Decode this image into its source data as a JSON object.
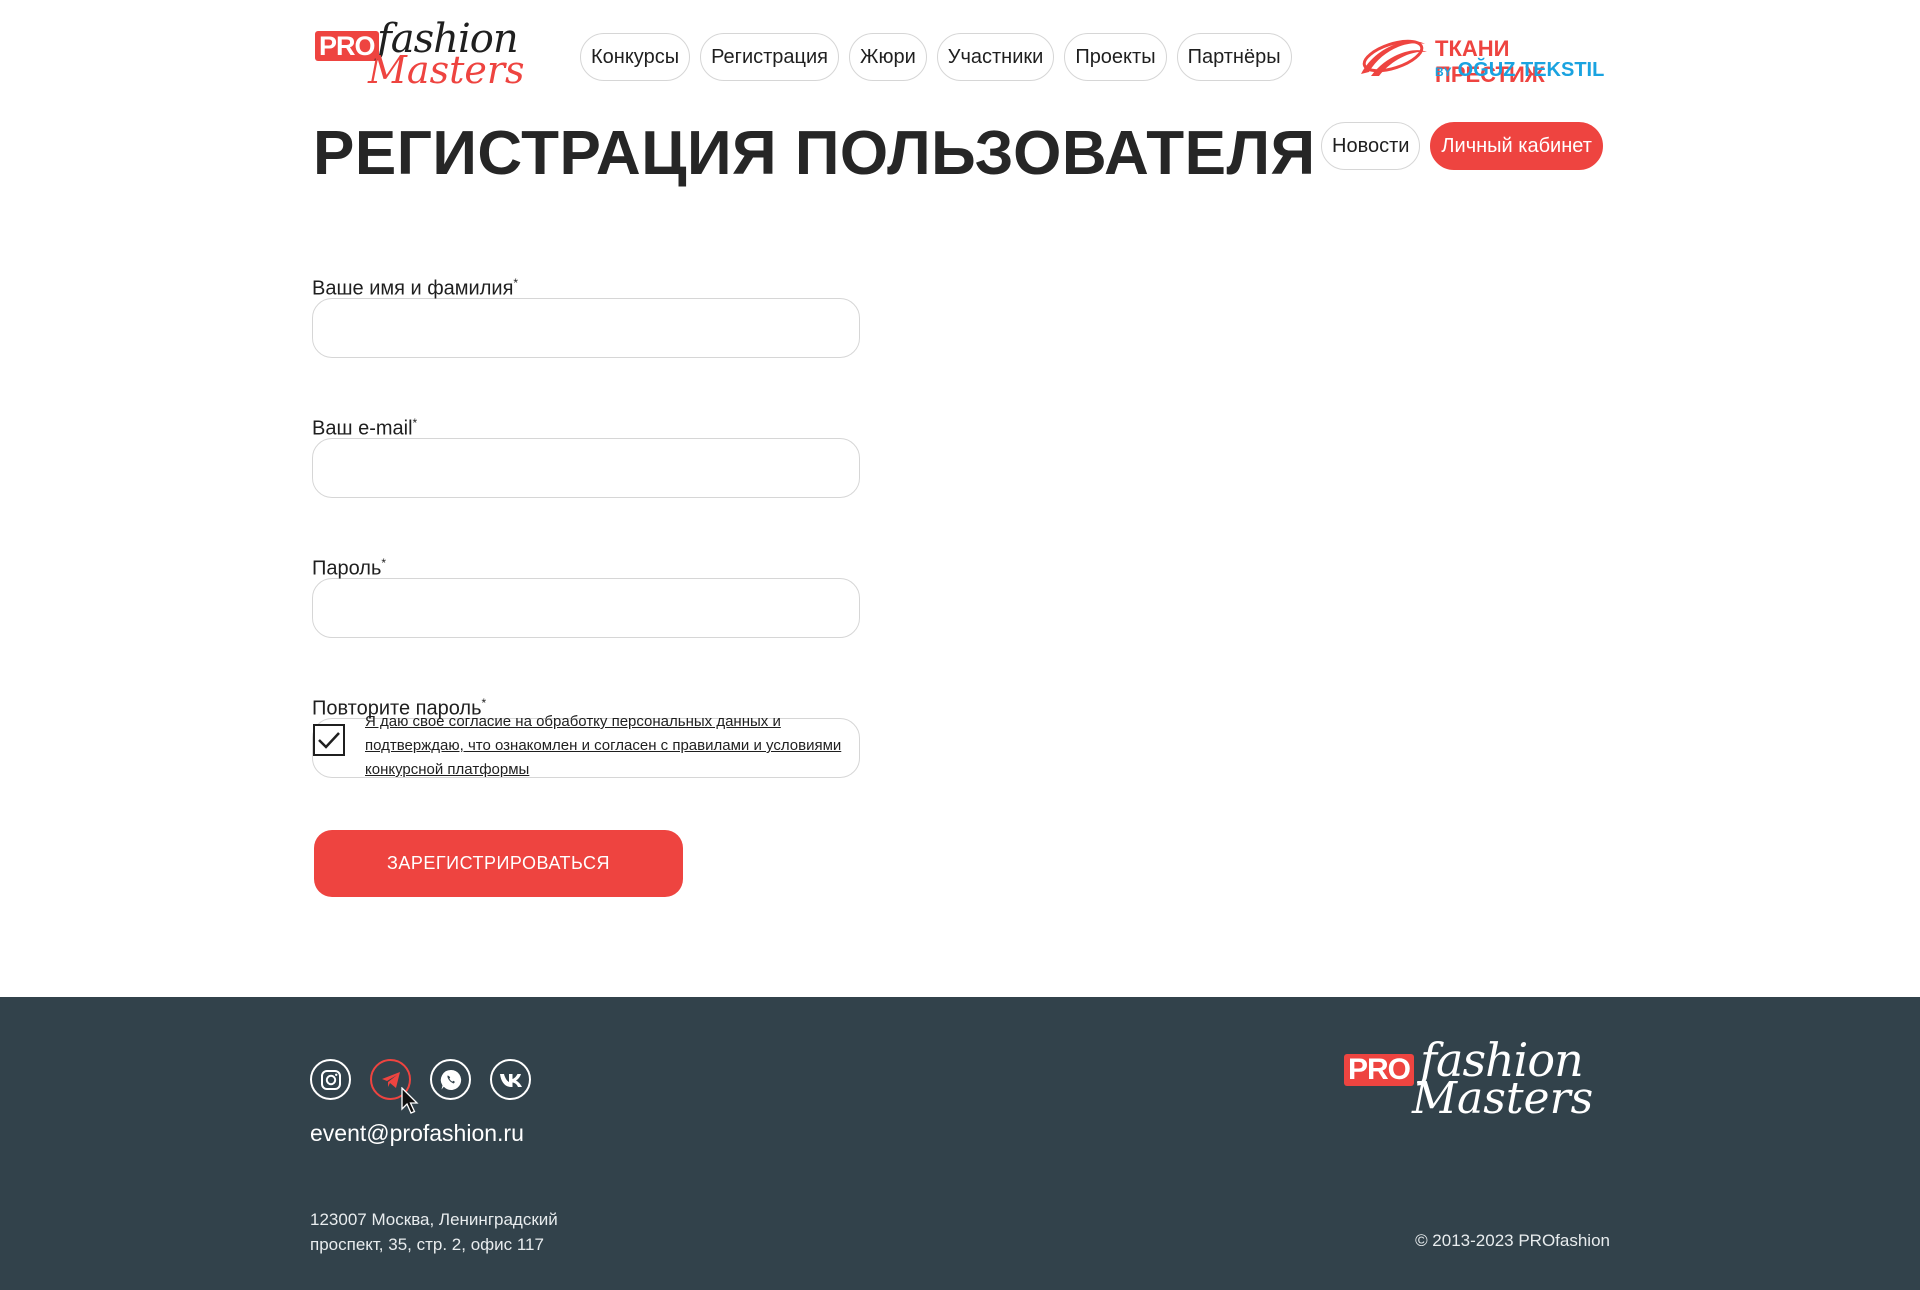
{
  "header": {
    "logo": {
      "pro": "PRO",
      "fashion": "fashion",
      "masters": "Masters"
    },
    "nav": [
      "Конкурсы",
      "Регистрация",
      "Жюри",
      "Участники",
      "Проекты",
      "Партнёры"
    ],
    "partner": {
      "line1": "ТКАНИ ПРЕСТИЖ",
      "by": "BY",
      "line2": "OĞUZ TEKSTIL"
    }
  },
  "page": {
    "title": "РЕГИСТРАЦИЯ ПОЛЬЗОВАТЕЛЯ",
    "news_button": "Новости",
    "account_button": "Личный кабинет"
  },
  "form": {
    "fields": [
      {
        "label": "Ваше имя и фамилия",
        "required": "*",
        "value": ""
      },
      {
        "label": "Ваш e-mail",
        "required": "*",
        "value": ""
      },
      {
        "label": "Пароль",
        "required": "*",
        "value": ""
      },
      {
        "label": "Повторите пароль",
        "required": "*",
        "value": ""
      }
    ],
    "consent_checked": true,
    "consent_text": "Я даю свое согласие на обработку персональных данных и подтверждаю, что ознакомлен и согласен с правилами и условиями конкурсной платформы",
    "submit": "ЗАРЕГИСТРИРОВАТЬСЯ"
  },
  "footer": {
    "socials": [
      "instagram-icon",
      "telegram-icon",
      "whatsapp-icon",
      "vk-icon"
    ],
    "email": "event@profashion.ru",
    "address_line1": "123007 Москва, Ленинградский",
    "address_line2": "проспект, 35, стр. 2, офис 117",
    "copyright": "© 2013-2023 PROfashion",
    "logo": {
      "pro": "PRO",
      "fashion": "fashion",
      "masters": "Masters"
    }
  },
  "colors": {
    "accent": "#ee4440",
    "footer_bg": "#32424b",
    "partner_blue": "#1aa3e0"
  }
}
